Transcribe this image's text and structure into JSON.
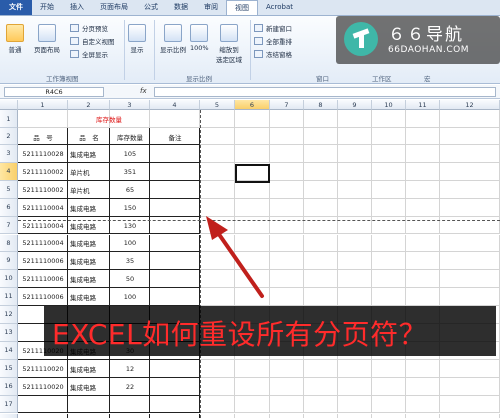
{
  "tabs": [
    "文件",
    "开始",
    "插入",
    "页面布局",
    "公式",
    "数据",
    "审阅",
    "视图",
    "Acrobat"
  ],
  "ribbon": {
    "normal": "普通",
    "page_layout": "页面布局",
    "page_break_preview": "分页预览",
    "custom_views": "自定义视图",
    "full_screen": "全屏显示",
    "group_workbook_views": "工作簿视图",
    "show": "显示",
    "zoom": "显示比例",
    "zoom_100": "100%",
    "zoom_selection_1": "缩放到",
    "zoom_selection_2": "选定区域",
    "group_zoom": "显示比例",
    "new_window": "新建窗口",
    "arrange_all": "全部重排",
    "freeze_panes": "冻结窗格",
    "group_window": "窗口",
    "save_workspace": "工作区",
    "macros": "宏"
  },
  "logo": {
    "title": "６６导航",
    "subtitle": "66DAOHAN.COM"
  },
  "formula_bar": {
    "name_box": "R4C6",
    "fx": "fx",
    "formula": ""
  },
  "columns": [
    "1",
    "2",
    "3",
    "4",
    "5",
    "6",
    "7",
    "8",
    "9",
    "10",
    "11",
    "12"
  ],
  "rows": [
    "1",
    "2",
    "3",
    "4",
    "5",
    "6",
    "7",
    "8",
    "9",
    "10",
    "11",
    "12",
    "13",
    "14",
    "15",
    "16",
    "17",
    "18"
  ],
  "sheet": {
    "title": "库存数量",
    "headers": [
      "品　号",
      "品　名",
      "库存数量",
      "备注"
    ],
    "data": [
      [
        "5211110028",
        "集成电路",
        "105",
        ""
      ],
      [
        "5211110002",
        "单片机",
        "351",
        ""
      ],
      [
        "5211110002",
        "单片机",
        "65",
        ""
      ],
      [
        "5211110004",
        "集成电路",
        "150",
        ""
      ],
      [
        "5211110004",
        "集成电路",
        "130",
        ""
      ],
      [
        "5211110004",
        "集成电路",
        "100",
        ""
      ],
      [
        "5211110006",
        "集成电路",
        "35",
        ""
      ],
      [
        "5211110006",
        "集成电路",
        "50",
        ""
      ],
      [
        "5211110006",
        "集成电路",
        "100",
        ""
      ],
      [
        "",
        "",
        "",
        ""
      ],
      [
        "",
        "",
        "",
        ""
      ],
      [
        "5211110020",
        "集成电路",
        "30",
        ""
      ],
      [
        "5211110020",
        "集成电路",
        "12",
        ""
      ],
      [
        "5211110020",
        "集成电路",
        "22",
        ""
      ]
    ]
  },
  "banner": "EXCEL如何重设所有分页符？",
  "colors": {
    "file_tab": "#2a5caa",
    "title_red": "#d11111",
    "arrow": "#c0201c",
    "banner_text": "#ff2b2b"
  }
}
